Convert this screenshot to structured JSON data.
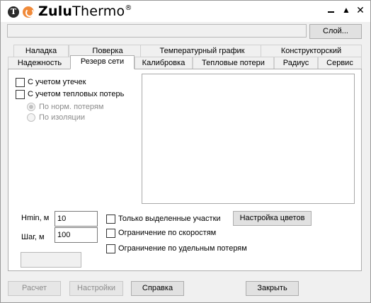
{
  "app": {
    "title_part1": "Zulu",
    "title_part2": "Thermo",
    "trademark": "®",
    "logo_letter": "T"
  },
  "window_controls": {
    "maximize_glyph": "▲",
    "close_glyph": "✕"
  },
  "toolbar": {
    "layer_field_value": "",
    "layer_button_label": "Слой..."
  },
  "tabs_row1": [
    {
      "label": "Наладка"
    },
    {
      "label": "Поверка"
    },
    {
      "label": "Температурный график"
    },
    {
      "label": "Конструкторский"
    }
  ],
  "tabs_row2": [
    {
      "label": "Надежность"
    },
    {
      "label": "Резерв сети",
      "active": true
    },
    {
      "label": "Калибровка"
    },
    {
      "label": "Тепловые потери"
    },
    {
      "label": "Радиус"
    },
    {
      "label": "Сервис"
    }
  ],
  "options": {
    "leaks_label": "С учетом утечек",
    "heat_loss_label": "С учетом тепловых потерь",
    "radio_norm_label": "По норм. потерям",
    "radio_insulation_label": "По изоляции"
  },
  "params": {
    "hmin_label": "Hmin, м",
    "hmin_value": "10",
    "step_label": "Шаг, м",
    "step_value": "100"
  },
  "filters": {
    "selected_only_label": "Только выделенные участки",
    "speed_limit_label": "Ограничение по скоростям",
    "specific_loss_label": "Ограничение по удельным потерям",
    "color_settings_button": "Настройка цветов"
  },
  "bottom_buttons": {
    "calculate": "Расчет",
    "settings": "Настройки",
    "help": "Справка",
    "close": "Закрыть"
  },
  "colors": {
    "logo_dark": "#2b2b2b",
    "logo_accent": "#f08a3a",
    "window_bg": "#f0f0f0"
  }
}
